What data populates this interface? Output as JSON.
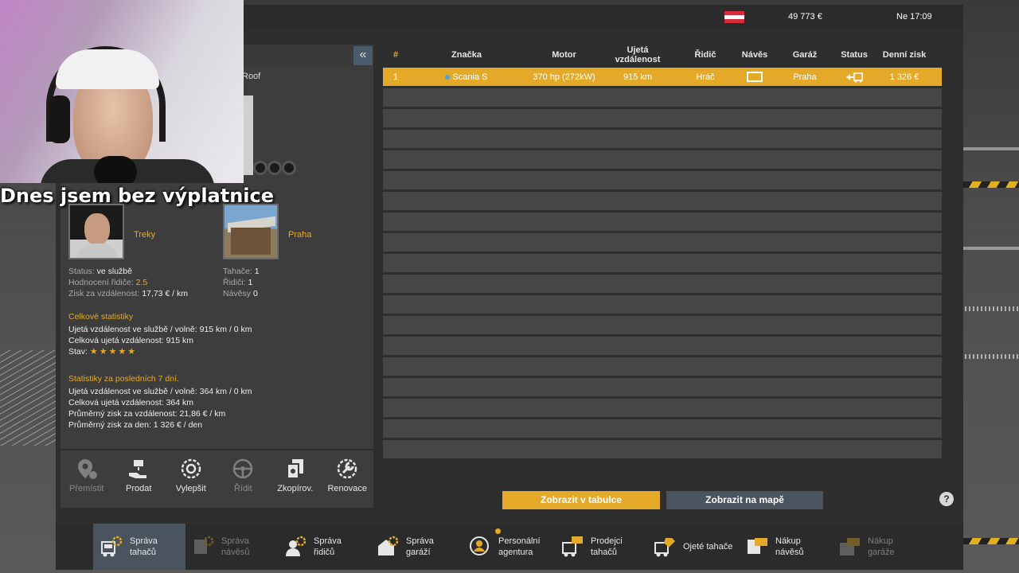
{
  "topbar": {
    "money": "49 773 €",
    "clock": "Ne 17:09"
  },
  "overlay": {
    "caption": "Dnes jsem bez výplatnice"
  },
  "truck": {
    "name_fragment": "Roof"
  },
  "driver": {
    "name": "Treky"
  },
  "garage": {
    "name": "Praha"
  },
  "driver_info": {
    "status_label": "Status:",
    "status_value": "ve službě",
    "rating_label": "Hodnocení řidiče:",
    "rating_value": "2.5",
    "profit_label": "Zisk za vzdálenost:",
    "profit_value": "17,73 € / km"
  },
  "garage_info": {
    "tractors_label": "Tahače:",
    "tractors_value": "1",
    "drivers_label": "Řidiči:",
    "drivers_value": "1",
    "trailers_label": "Návěsy",
    "trailers_value": "0"
  },
  "total_stats": {
    "title": "Celkové statistiky",
    "line1_label": "Ujetá vzdálenost ve službě / volně:",
    "line1_value": "915 km / 0 km",
    "line2_label": "Celková ujetá vzdálenost:",
    "line2_value": "915 km",
    "line3_label": "Stav:",
    "stars": "★★★★★"
  },
  "week_stats": {
    "title": "Statistiky za posledních 7 dní.",
    "line1_label": "Ujetá vzdálenost ve službě / volně:",
    "line1_value": "364 km / 0 km",
    "line2_label": "Celková ujetá vzdálenost:",
    "line2_value": "364 km",
    "line3_label": "Průměrný zisk za vzdálenost:",
    "line3_value": "21,86 € / km",
    "line4_label": "Průměrný zisk za den:",
    "line4_value": "1 326 € / den"
  },
  "actions": [
    "Přemístit",
    "Prodat",
    "Vylepšit",
    "Řídit",
    "Zkopírov.",
    "Renovace"
  ],
  "table": {
    "headers": [
      "#",
      "Značka",
      "Motor",
      "Ujetá vzdálenost",
      "Řidič",
      "Návěs",
      "Garáž",
      "Status",
      "Denní zisk"
    ],
    "rows": [
      {
        "num": "1",
        "brand": "Scania S",
        "engine": "370 hp (272kW)",
        "distance": "915 km",
        "driver": "Hráč",
        "garage": "Praha",
        "profit": "1 326 €"
      }
    ]
  },
  "buttons": {
    "table_view": "Zobrazit v tabulce",
    "map_view": "Zobrazit na mapě",
    "help": "?"
  },
  "nav": {
    "tractors": "Správa tahačů",
    "trailers": "Správa návěsů",
    "drivers": "Správa řidičů",
    "garages": "Správa garáží",
    "agency": "Personální agentura",
    "dealers": "Prodejci tahačů",
    "used": "Ojeté tahače",
    "buy_trailers": "Nákup návěsů",
    "buy_garages": "Nákup garáže"
  },
  "colors": {
    "accent": "#e5a92a",
    "panel": "#3d3d3d",
    "active_nav": "#4a545e",
    "flag_red": "#d62b3b"
  }
}
